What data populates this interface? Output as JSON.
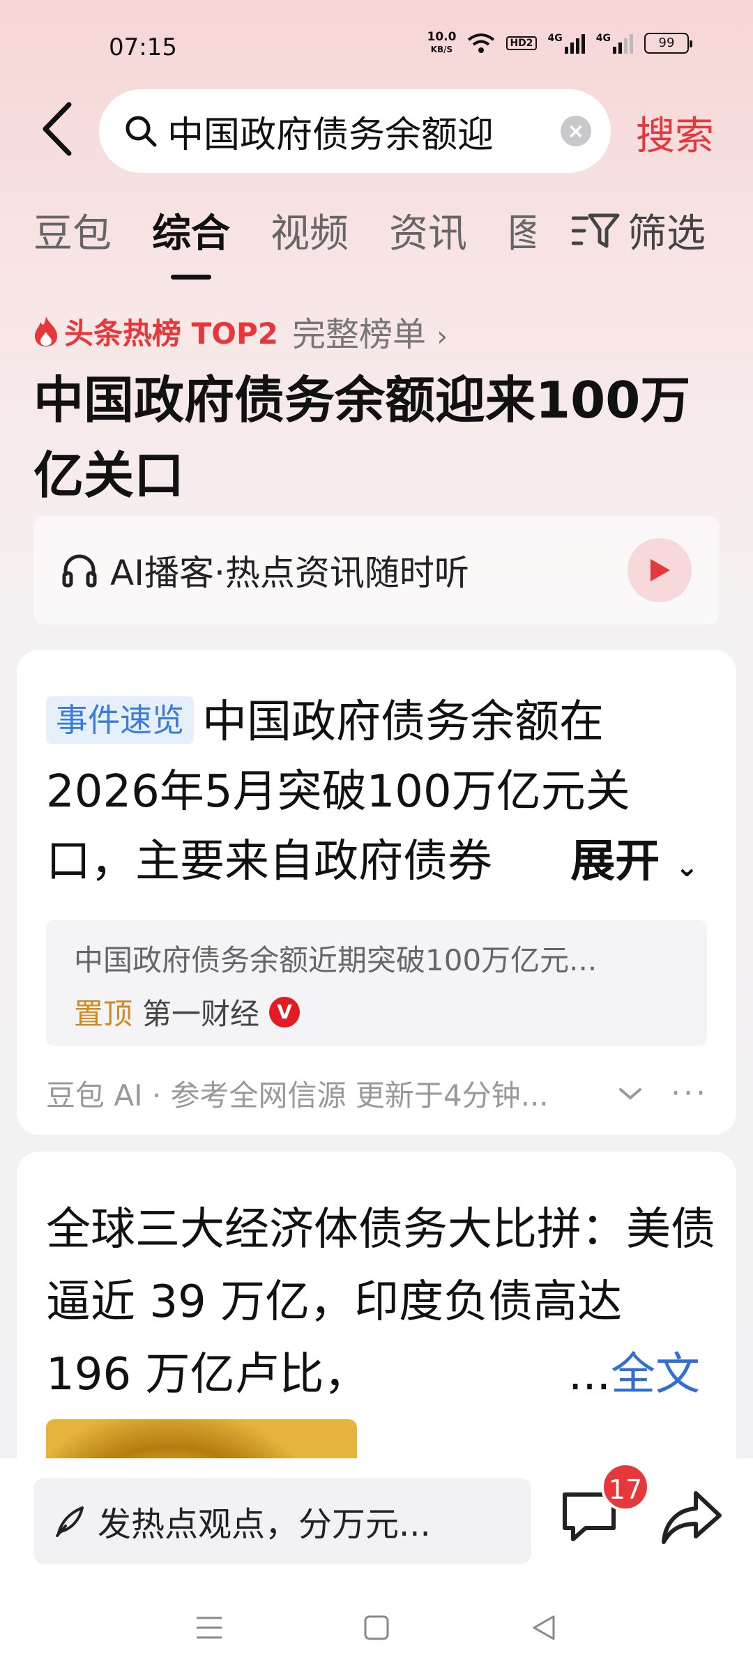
{
  "status_bar": {
    "time": "07:15",
    "net_speed_value": "10.0",
    "net_speed_unit": "KB/S",
    "hd_label": "HD2",
    "signal1_label": "4G",
    "signal2_label": "4G",
    "battery": "99"
  },
  "search": {
    "query": "中国政府债务余额迎",
    "submit_label": "搜索"
  },
  "tabs": [
    {
      "label": "豆包"
    },
    {
      "label": "综合"
    },
    {
      "label": "视频"
    },
    {
      "label": "资讯"
    },
    {
      "label": "图"
    }
  ],
  "filter_label": "筛选",
  "hot": {
    "rank_label": "头条热榜 TOP2",
    "full_list_label": "完整榜单",
    "title": "中国政府债务余额迎来100万亿关口"
  },
  "podcast": {
    "label": "AI播客·热点资讯随时听"
  },
  "event_card": {
    "tag": "事件速览",
    "headline": "中国政府债务余额在2026年5月突破100万亿元关口，主要来自政府债券",
    "expand_label": "展开",
    "source_snippet": "中国政府债务余额近期突破100万亿元...",
    "pinned_label": "置顶",
    "source_name": "第一财经",
    "verified_mark": "V",
    "footer": "豆包 AI · 参考全网信源 更新于4分钟..."
  },
  "article_card": {
    "title": "全球三大经济体债务大比拼：美债逼近 39 万亿，印度负债高达 196 万亿卢比，",
    "ellipsis": "...",
    "full_text_label": "全文"
  },
  "bottom": {
    "comment_placeholder": "发热点观点，分万元...",
    "comment_count": "17"
  }
}
